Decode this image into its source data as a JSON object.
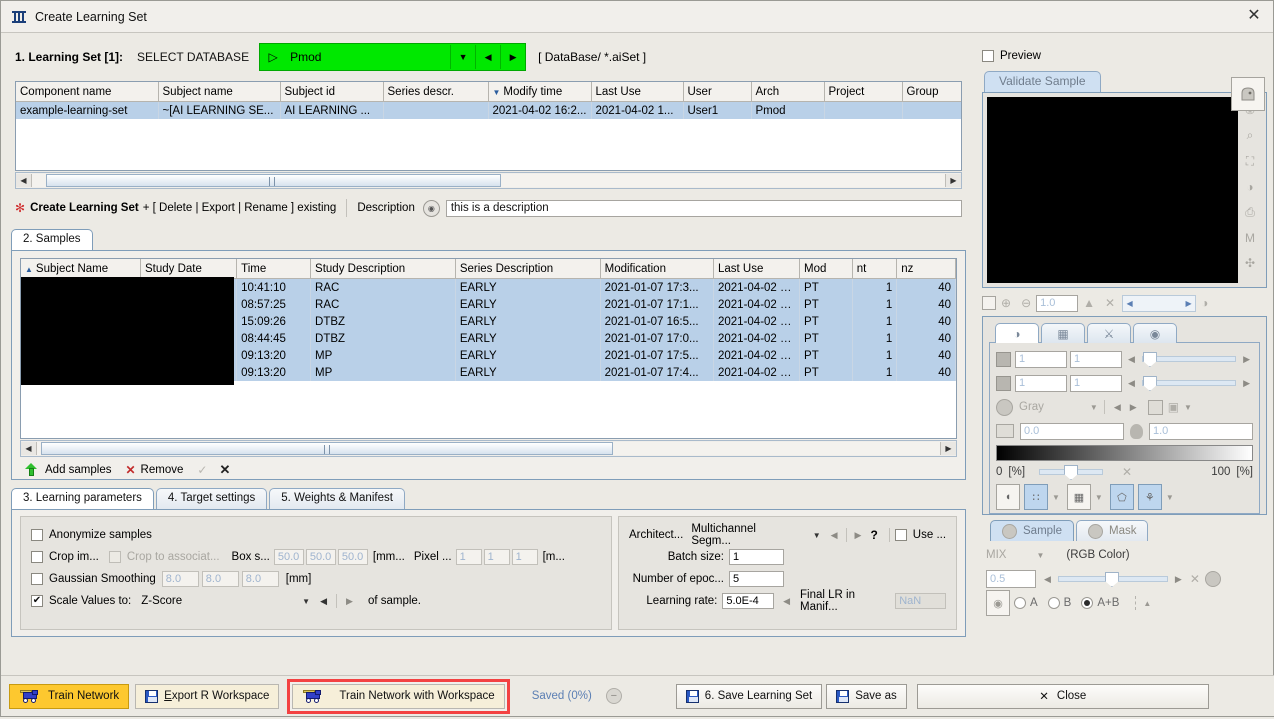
{
  "window": {
    "title": "Create Learning Set",
    "close_label": "✕"
  },
  "database_row": {
    "learning_set_label": "1. Learning Set [1]:",
    "select_database_label": "SELECT DATABASE",
    "database_name": "Pmod",
    "path_label": "[ DataBase/ *.aiSet ]"
  },
  "component_table": {
    "columns": [
      "Component name",
      "Subject name",
      "Subject id",
      "Series descr.",
      "Modify time",
      "Last Use",
      "User",
      "Arch",
      "Project",
      "Group"
    ],
    "sorted_column": "Modify time",
    "rows": [
      [
        "example-learning-set",
        "~[AI LEARNING SE...",
        "AI LEARNING ...",
        "",
        "2021-04-02 16:2...",
        "2021-04-02 1...",
        "User1",
        "Pmod",
        "",
        ""
      ]
    ]
  },
  "create_row": {
    "create_text": "Create Learning Set",
    "create_suffix": "+ [ Delete | Export | Rename ] existing",
    "description_label": "Description",
    "description_value": "this is a description"
  },
  "samples": {
    "tab_label": "2. Samples",
    "columns": [
      "Subject Name",
      "Study Date",
      "Time",
      "Study Description",
      "Series Description",
      "Modification",
      "Last Use",
      "Mod",
      "nt",
      "nz"
    ],
    "sorted_column": "Subject Name",
    "rows": [
      [
        "",
        "",
        "10:41:10",
        "RAC",
        "EARLY",
        "2021-01-07 17:3...",
        "2021-04-02 1...",
        "PT",
        "1",
        "40"
      ],
      [
        "",
        "",
        "08:57:25",
        "RAC",
        "EARLY",
        "2021-01-07 17:1...",
        "2021-04-02 1...",
        "PT",
        "1",
        "40"
      ],
      [
        "",
        "",
        "15:09:26",
        "DTBZ",
        "EARLY",
        "2021-01-07 16:5...",
        "2021-04-02 1...",
        "PT",
        "1",
        "40"
      ],
      [
        "",
        "",
        "08:44:45",
        "DTBZ",
        "EARLY",
        "2021-01-07 17:0...",
        "2021-04-02 1...",
        "PT",
        "1",
        "40"
      ],
      [
        "",
        "",
        "09:13:20",
        "MP",
        "EARLY",
        "2021-01-07 17:5...",
        "2021-04-02 1...",
        "PT",
        "1",
        "40"
      ],
      [
        "",
        "",
        "09:13:20",
        "MP",
        "EARLY",
        "2021-01-07 17:4...",
        "2021-04-02 1...",
        "PT",
        "1",
        "40"
      ]
    ],
    "add_samples_label": "Add samples",
    "remove_label": "Remove"
  },
  "param_tabs": [
    {
      "label": "3. Learning parameters",
      "active": true
    },
    {
      "label": "4. Target settings",
      "active": false
    },
    {
      "label": "5. Weights & Manifest",
      "active": false
    }
  ],
  "learning_parameters": {
    "anonymize_label": "Anonymize samples",
    "anonymize_checked": false,
    "crop_label": "Crop im...",
    "crop_checked": false,
    "crop_assoc_label": "Crop to associat...",
    "crop_assoc_checked": false,
    "box_size_label": "Box s...",
    "box_size": [
      "50.0",
      "50.0",
      "50.0"
    ],
    "box_units": "[mm...",
    "pixel_label": "Pixel ...",
    "pixel_size": [
      "1",
      "1",
      "1"
    ],
    "pixel_units": "[m...",
    "gaussian_label": "Gaussian Smoothing",
    "gaussian_checked": false,
    "gaussian_values": [
      "8.0",
      "8.0",
      "8.0"
    ],
    "gaussian_units": "[mm]",
    "scale_label": "Scale Values to:",
    "scale_checked": true,
    "scale_value": "Z-Score",
    "scale_suffix": "of sample."
  },
  "network_parameters": {
    "architecture_label": "Architect...",
    "architecture_value": "Multichannel Segm...",
    "help_glyph": "?",
    "use_label": "Use ...",
    "use_checked": false,
    "batch_size_label": "Batch size:",
    "batch_size_value": "1",
    "epochs_label": "Number of epoc...",
    "epochs_value": "5",
    "learning_rate_label": "Learning rate:",
    "learning_rate_value": "5.0E-4",
    "final_lr_label": "Final LR in Manif...",
    "final_lr_value": "NaN"
  },
  "bottom_bar": {
    "train_network_label": "Train Network",
    "export_r_label": "Export R Workspace",
    "train_with_workspace_label": "Train Network with Workspace",
    "train_with_workspace_highlighted": true,
    "highlight_color": "#f34242",
    "saved_label": "Saved (0%)",
    "save_learning_set_label": "6. Save Learning Set",
    "save_as_label": "Save as",
    "close_label": "Close"
  },
  "right_panel": {
    "preview_label": "Preview",
    "preview_checked": false,
    "validate_tab_label": "Validate Sample",
    "zoom_value": "1.0",
    "range_fields": [
      [
        "1",
        "1"
      ],
      [
        "1",
        "1"
      ]
    ],
    "colormap_name": "Gray",
    "level_low": "0.0",
    "level_high": "1.0",
    "pct_min": "0",
    "pct_min_unit": "[%]",
    "pct_max": "100",
    "pct_max_unit": "[%]",
    "sample_tab_label": "Sample",
    "mask_tab_label": "Mask",
    "mix_label": "MIX",
    "color_mode_label": "(RGB Color)",
    "mix_value": "0.5",
    "ab_options": [
      "A",
      "B",
      "A+B"
    ],
    "ab_selected": "A+B"
  }
}
